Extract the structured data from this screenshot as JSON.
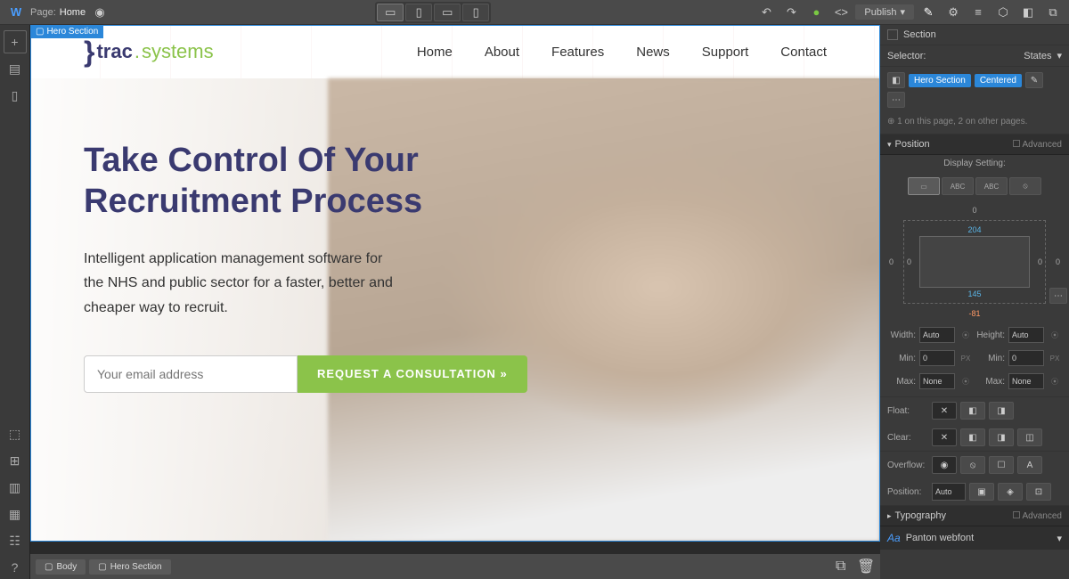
{
  "topbar": {
    "page_label": "Page:",
    "page_name": "Home",
    "publish_label": "Publish"
  },
  "leftbar": {
    "icons": [
      "add",
      "page",
      "select",
      "grid",
      "interactions",
      "cms",
      "users",
      "help"
    ]
  },
  "selection": {
    "tag": "Hero Section"
  },
  "page": {
    "logo": {
      "brace": "}",
      "text1": "trac",
      "dot": ".",
      "text2": "systems"
    },
    "nav": [
      "Home",
      "About",
      "Features",
      "News",
      "Support",
      "Contact"
    ],
    "hero": {
      "title_l1": "Take Control Of Your",
      "title_l2": "Recruitment Process",
      "body": "Intelligent application management software for the NHS and public sector for a faster, better and cheaper way to recruit.",
      "email_placeholder": "Your email address",
      "cta": "REQUEST A CONSULTATION »"
    }
  },
  "breadcrumb": {
    "items": [
      "Body",
      "Hero Section"
    ]
  },
  "panel": {
    "section_label": "Section",
    "selector_label": "Selector:",
    "states_label": "States",
    "classes": [
      "Hero Section",
      "Centered"
    ],
    "info": "1 on this page, 2 on other pages.",
    "position_section": "Position",
    "advanced": "Advanced",
    "display_setting": "Display Setting:",
    "box": {
      "top": "0",
      "right": "0",
      "bottom": "-81",
      "left": "0",
      "ptop": "204",
      "pbottom": "145",
      "pleft": "0",
      "pright": "0"
    },
    "width_label": "Width:",
    "width_val": "Auto",
    "height_label": "Height:",
    "height_val": "Auto",
    "min_label": "Min:",
    "min_val": "0",
    "min_unit": "PX",
    "max_label": "Max:",
    "max_val": "None",
    "float_label": "Float:",
    "clear_label": "Clear:",
    "overflow_label": "Overflow:",
    "position_label": "Position:",
    "position_val": "Auto",
    "typo_section": "Typography",
    "font": "Panton webfont"
  }
}
